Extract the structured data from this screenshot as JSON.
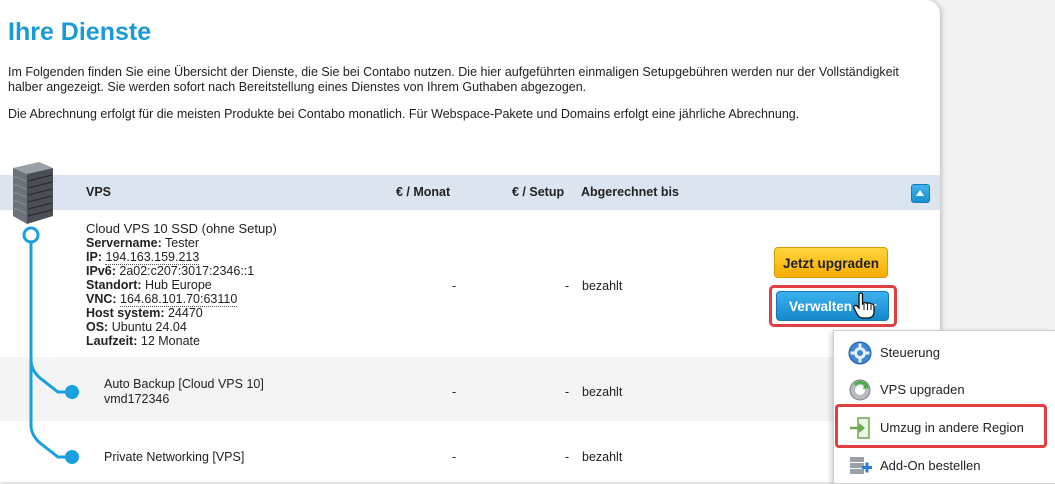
{
  "page": {
    "title": "Ihre Dienste",
    "intro_1": "Im Folgenden finden Sie eine Übersicht der Dienste, die Sie bei Contabo nutzen. Die hier aufgeführten einmaligen Setupgebühren werden nur der Vollständigkeit halber angezeigt. Sie werden sofort nach Bereitstellung eines Dienstes von Ihrem Guthaben abgezogen.",
    "intro_2": "Die Abrechnung erfolgt für die meisten Produkte bei Contabo monatlich. Für Webspace-Pakete und Domains erfolgt eine jährliche Abrechnung."
  },
  "table": {
    "headers": {
      "vps": "VPS",
      "monat": "€ / Monat",
      "setup": "€ / Setup",
      "bis": "Abgerechnet bis"
    },
    "main_row": {
      "product_name": "Cloud VPS 10 SSD (ohne Setup)",
      "servername_label": "Servername:",
      "servername": "Tester",
      "ip_label": "IP:",
      "ip": "194.163.159.213",
      "ipv6_label": "IPv6:",
      "ipv6": "2a02:c207:3017:2346::1",
      "standort_label": "Standort:",
      "standort": "Hub Europe",
      "vnc_label": "VNC:",
      "vnc": "164.68.101.70:63110",
      "host_label": "Host system:",
      "host": "24470",
      "os_label": "OS:",
      "os": "Ubuntu 24.04",
      "laufzeit_label": "Laufzeit:",
      "laufzeit": "12 Monate",
      "monat": "-",
      "setup": "-",
      "status": "bezahlt"
    },
    "sub_rows": [
      {
        "name": "Auto Backup [Cloud VPS 10]",
        "detail": "vmd172346",
        "monat": "-",
        "setup": "-",
        "status": "bezahlt"
      },
      {
        "name": "Private Networking [VPS]",
        "detail": "",
        "monat": "-",
        "setup": "-",
        "status": "bezahlt"
      }
    ]
  },
  "buttons": {
    "upgrade": "Jetzt upgraden",
    "verwalten": "Verwalten"
  },
  "menu": {
    "items": [
      {
        "label": "Steuerung",
        "icon": "gear-icon"
      },
      {
        "label": "VPS upgraden",
        "icon": "upgrade-gear-icon"
      },
      {
        "label": "Umzug in andere Region",
        "icon": "move-region-icon"
      },
      {
        "label": "Add-On bestellen",
        "icon": "add-on-icon"
      }
    ]
  },
  "colors": {
    "brand_blue": "#1a9bd8",
    "header_bg": "#dce4ef",
    "upgrade_yellow": "#f6ad00",
    "highlight_red": "#e0403f"
  }
}
